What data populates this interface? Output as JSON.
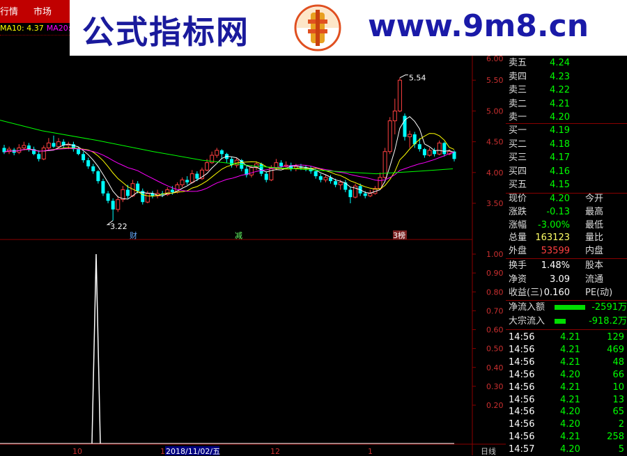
{
  "menu": {
    "item1": "行情",
    "item2": "市场"
  },
  "ma": {
    "ma10_label": "MA10: 4.37",
    "ma20_label": "MA20:"
  },
  "banner": {
    "title": "公式指标网",
    "url": "www.9m8.cn"
  },
  "price_axis": [
    "5.50",
    "5.00",
    "4.50",
    "4.00",
    "3.50"
  ],
  "price_axis_top": "6.00",
  "vol_axis": [
    "1.00",
    "0.90",
    "0.80",
    "0.70",
    "0.60",
    "0.50",
    "0.40",
    "0.30",
    "0.20"
  ],
  "annotations": {
    "high": "5.54",
    "low": "3.22",
    "cai": "财",
    "jian": "减",
    "bang": "榜"
  },
  "time_axis": {
    "t1": "10",
    "t2": "1",
    "date": "2018/11/02/五",
    "t3": "12",
    "t4": "1",
    "period": "日线"
  },
  "quote": {
    "asks": [
      {
        "label": "卖五",
        "price": "4.24"
      },
      {
        "label": "卖四",
        "price": "4.23"
      },
      {
        "label": "卖三",
        "price": "4.22"
      },
      {
        "label": "卖二",
        "price": "4.21"
      },
      {
        "label": "卖一",
        "price": "4.20"
      }
    ],
    "bids": [
      {
        "label": "买一",
        "price": "4.19"
      },
      {
        "label": "买二",
        "price": "4.18"
      },
      {
        "label": "买三",
        "price": "4.17"
      },
      {
        "label": "买四",
        "price": "4.16"
      },
      {
        "label": "买五",
        "price": "4.15"
      }
    ],
    "stats": [
      {
        "label": "现价",
        "value": "4.20",
        "extra": "今开",
        "color": "green"
      },
      {
        "label": "涨跌",
        "value": "-0.13",
        "extra": "最高",
        "color": "green"
      },
      {
        "label": "涨幅",
        "value": "-3.00%",
        "extra": "最低",
        "color": "green"
      },
      {
        "label": "总量",
        "value": "163123",
        "extra": "量比",
        "color": "yellow"
      },
      {
        "label": "外盘",
        "value": "53599",
        "extra": "内盘",
        "color": "red"
      }
    ],
    "stats2": [
      {
        "label": "换手",
        "value": "1.48%",
        "extra": "股本",
        "color": "white"
      },
      {
        "label": "净资",
        "value": "3.09",
        "extra": "流通",
        "color": "white"
      },
      {
        "label": "收益(三)",
        "value": "0.160",
        "extra": "PE(动)",
        "color": "white"
      }
    ],
    "flows": [
      {
        "label": "净流入额",
        "value": "-2591万",
        "bar": 0.85
      },
      {
        "label": "大宗流入",
        "value": "-918.2万",
        "bar": 0.3
      }
    ],
    "ticks": [
      {
        "time": "14:56",
        "price": "4.21",
        "vol": "129"
      },
      {
        "time": "14:56",
        "price": "4.21",
        "vol": "469"
      },
      {
        "time": "14:56",
        "price": "4.21",
        "vol": "48"
      },
      {
        "time": "14:56",
        "price": "4.20",
        "vol": "66"
      },
      {
        "time": "14:56",
        "price": "4.21",
        "vol": "10"
      },
      {
        "time": "14:56",
        "price": "4.21",
        "vol": "13"
      },
      {
        "time": "14:56",
        "price": "4.20",
        "vol": "65"
      },
      {
        "time": "14:56",
        "price": "4.20",
        "vol": "2"
      },
      {
        "time": "14:56",
        "price": "4.21",
        "vol": "258"
      },
      {
        "time": "14:57",
        "price": "4.20",
        "vol": "5"
      }
    ]
  },
  "colors": {
    "up": "#ff4040",
    "down": "#00ffff",
    "ma5": "#ffffff",
    "ma10": "#ffff00",
    "ma20": "#ff00ff",
    "ma60": "#00ff00",
    "grid": "#8b0000"
  }
}
